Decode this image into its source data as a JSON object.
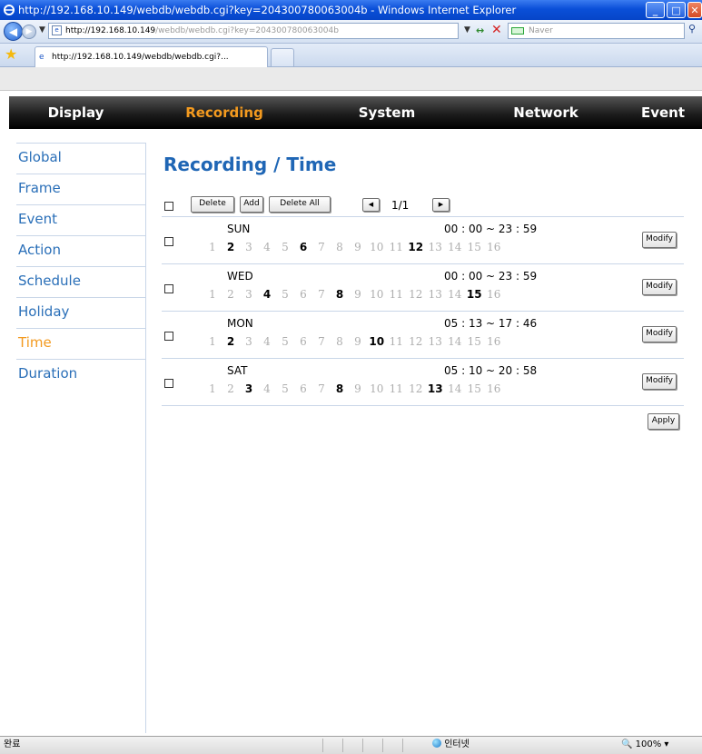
{
  "browser": {
    "title": "http://192.168.10.149/webdb/webdb.cgi?key=204300780063004b - Windows Internet Explorer",
    "address_host": "http://192.168.10.149",
    "address_rest": "/webdb/webdb.cgi?key=204300780063004b",
    "search_placeholder": "Naver",
    "tab_label": "http://192.168.10.149/webdb/webdb.cgi?...",
    "status_left": "완료",
    "status_zone": "인터넷",
    "zoom": "100%"
  },
  "top_nav": {
    "items": [
      {
        "label": "Display"
      },
      {
        "label": "Recording"
      },
      {
        "label": "System"
      },
      {
        "label": "Network"
      },
      {
        "label": "Event"
      }
    ],
    "active": "Recording"
  },
  "sidebar": {
    "items": [
      {
        "label": "Global"
      },
      {
        "label": "Frame"
      },
      {
        "label": "Event"
      },
      {
        "label": "Action"
      },
      {
        "label": "Schedule"
      },
      {
        "label": "Holiday"
      },
      {
        "label": "Time"
      },
      {
        "label": "Duration"
      }
    ],
    "active": "Time"
  },
  "page": {
    "title": "Recording / Time",
    "buttons": {
      "delete": "Delete",
      "add": "Add",
      "delete_all": "Delete All",
      "modify": "Modify",
      "apply": "Apply"
    },
    "pager": "1/1"
  },
  "schedules": [
    {
      "day": "SUN",
      "time": "00 : 00 ~ 23 : 59",
      "weeks_on": [
        2,
        6,
        12
      ]
    },
    {
      "day": "WED",
      "time": "00 : 00 ~ 23 : 59",
      "weeks_on": [
        4,
        8,
        15
      ]
    },
    {
      "day": "MON",
      "time": "05 : 13 ~ 17 : 46",
      "weeks_on": [
        2,
        10
      ]
    },
    {
      "day": "SAT",
      "time": "05 : 10 ~ 20 : 58",
      "weeks_on": [
        3,
        8,
        13
      ]
    }
  ],
  "week_numbers": [
    "1",
    "2",
    "3",
    "4",
    "5",
    "6",
    "7",
    "8",
    "9",
    "10",
    "11",
    "12",
    "13",
    "14",
    "15",
    "16"
  ],
  "colors": {
    "accent_orange": "#f39a1f",
    "link_blue": "#2a6fb8",
    "title_blue": "#1f66b5"
  }
}
